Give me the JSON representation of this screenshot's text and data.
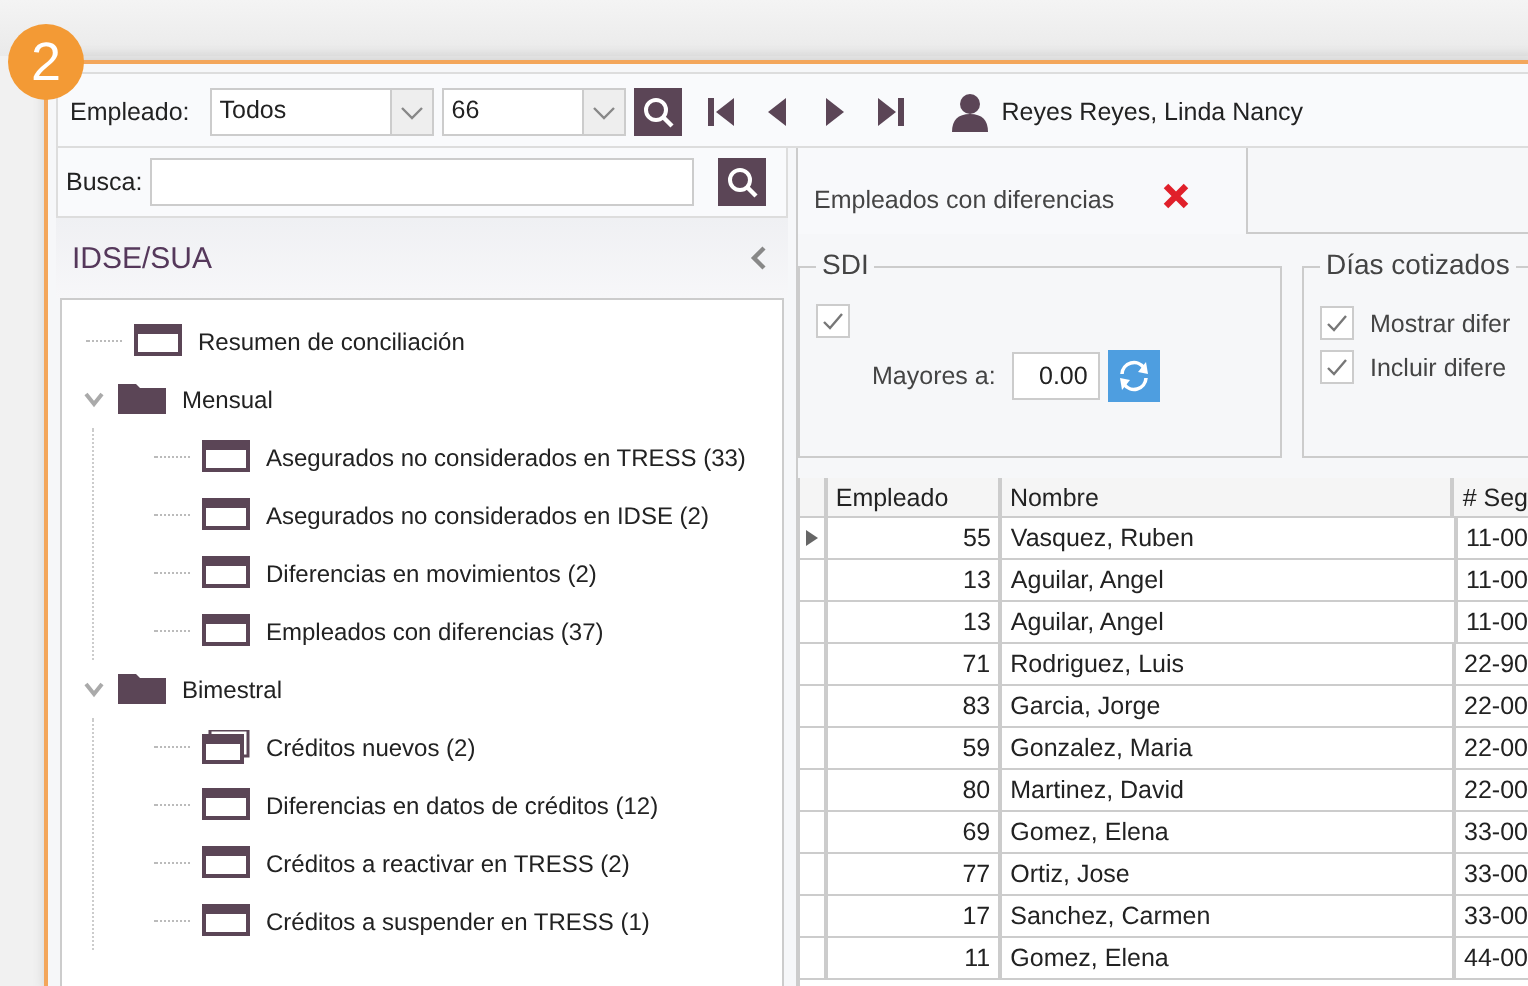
{
  "badge": "2",
  "toolbar": {
    "label": "Empleado:",
    "filter": "Todos",
    "number": "66",
    "employee": "Reyes Reyes, Linda Nancy"
  },
  "search": {
    "label": "Busca:"
  },
  "sidebar": {
    "title": "IDSE/SUA",
    "tree": [
      {
        "label": "Resumen de conciliación",
        "kind": "window"
      },
      {
        "label": "Mensual",
        "kind": "folder",
        "expanded": true,
        "children": [
          {
            "label": "Asegurados no considerados en TRESS (33)",
            "kind": "window"
          },
          {
            "label": "Asegurados no considerados en IDSE (2)",
            "kind": "window"
          },
          {
            "label": "Diferencias en movimientos (2)",
            "kind": "window"
          },
          {
            "label": "Empleados con diferencias (37)",
            "kind": "window"
          }
        ]
      },
      {
        "label": "Bimestral",
        "kind": "folder",
        "expanded": true,
        "children": [
          {
            "label": "Créditos nuevos (2)",
            "kind": "windows"
          },
          {
            "label": "Diferencias en datos de créditos (12)",
            "kind": "window"
          },
          {
            "label": "Créditos a reactivar en TRESS (2)",
            "kind": "window"
          },
          {
            "label": "Créditos a suspender en TRESS (1)",
            "kind": "window"
          }
        ]
      }
    ]
  },
  "tab": {
    "label": "Empleados con diferencias",
    "selected": true
  },
  "sdi": {
    "title": "SDI",
    "checked": true,
    "label": "Mayores a:",
    "value": "0.00"
  },
  "dias": {
    "title": "Días cotizados",
    "options": [
      {
        "label": "Mostrar difer",
        "checked": true
      },
      {
        "label": "Incluir difere",
        "checked": true
      }
    ]
  },
  "table": {
    "columns": [
      "Empleado",
      "Nombre",
      "# Seg"
    ],
    "rows": [
      {
        "current": true,
        "cells": [
          "55",
          "Vasquez, Ruben",
          "11-00"
        ]
      },
      {
        "current": false,
        "cells": [
          "13",
          "Aguilar, Angel",
          "11-00"
        ]
      },
      {
        "current": false,
        "cells": [
          "13",
          "Aguilar, Angel",
          "11-00"
        ]
      },
      {
        "current": false,
        "cells": [
          "71",
          "Rodriguez, Luis",
          "22-90"
        ]
      },
      {
        "current": false,
        "cells": [
          "83",
          "Garcia, Jorge",
          "22-00"
        ]
      },
      {
        "current": false,
        "cells": [
          "59",
          "Gonzalez, Maria",
          "22-00"
        ]
      },
      {
        "current": false,
        "cells": [
          "80",
          "Martinez, David",
          "22-00"
        ]
      },
      {
        "current": false,
        "cells": [
          "69",
          "Gomez, Elena",
          "33-00"
        ]
      },
      {
        "current": false,
        "cells": [
          "77",
          "Ortiz, Jose",
          "33-00"
        ]
      },
      {
        "current": false,
        "cells": [
          "17",
          "Sanchez, Carmen",
          "33-00"
        ]
      },
      {
        "current": false,
        "cells": [
          "11",
          "Gomez, Elena",
          "44-00"
        ]
      }
    ]
  }
}
